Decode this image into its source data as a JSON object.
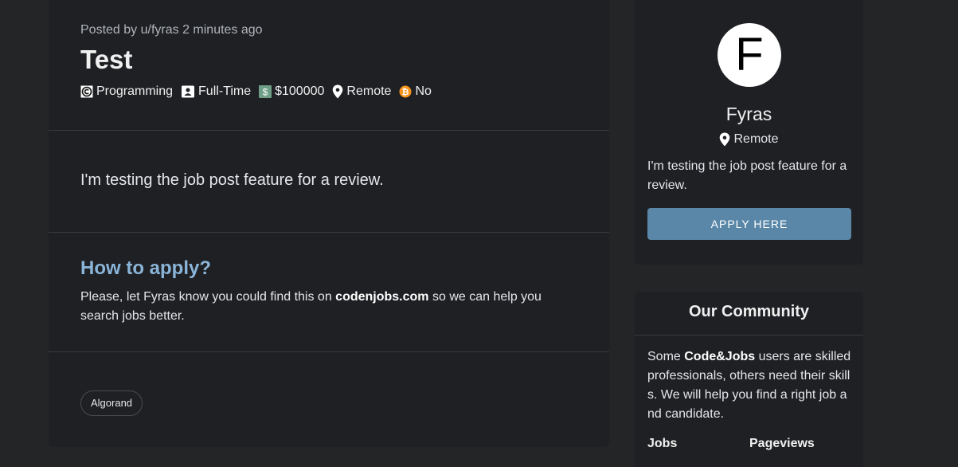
{
  "post": {
    "posted_by": "Posted by u/fyras 2 minutes ago",
    "title": "Test",
    "meta": {
      "category": "Programming",
      "job_type": "Full-Time",
      "salary": "$100000",
      "location": "Remote",
      "crypto": "No"
    },
    "description": "I'm testing the job post feature for a review.",
    "how_to_apply": {
      "heading": "How to apply?",
      "text_before": "Please, let Fyras know you could find this on ",
      "site": "codenjobs.com",
      "text_after": " so we can help you search jobs better."
    },
    "tags": [
      "Algorand"
    ]
  },
  "author_card": {
    "avatar_letter": "F",
    "name": "Fyras",
    "location": "Remote",
    "description": "I'm testing the job post feature for a review.",
    "apply_label": "APPLY HERE"
  },
  "community": {
    "title": "Our Community",
    "text_before": "Some ",
    "brand": "Code&Jobs",
    "text_after": " users are skilled professionals, others need their skills. We will help you find a right job and candidate.",
    "stats_labels": [
      "Jobs",
      "Pageviews"
    ]
  },
  "colors": {
    "background": "#242526",
    "card": "#1e2023",
    "accent_heading": "#8ab4d8",
    "apply_button": "#5a87a8",
    "salary_icon": "#6e9e87",
    "crypto_icon": "#f7931a"
  }
}
